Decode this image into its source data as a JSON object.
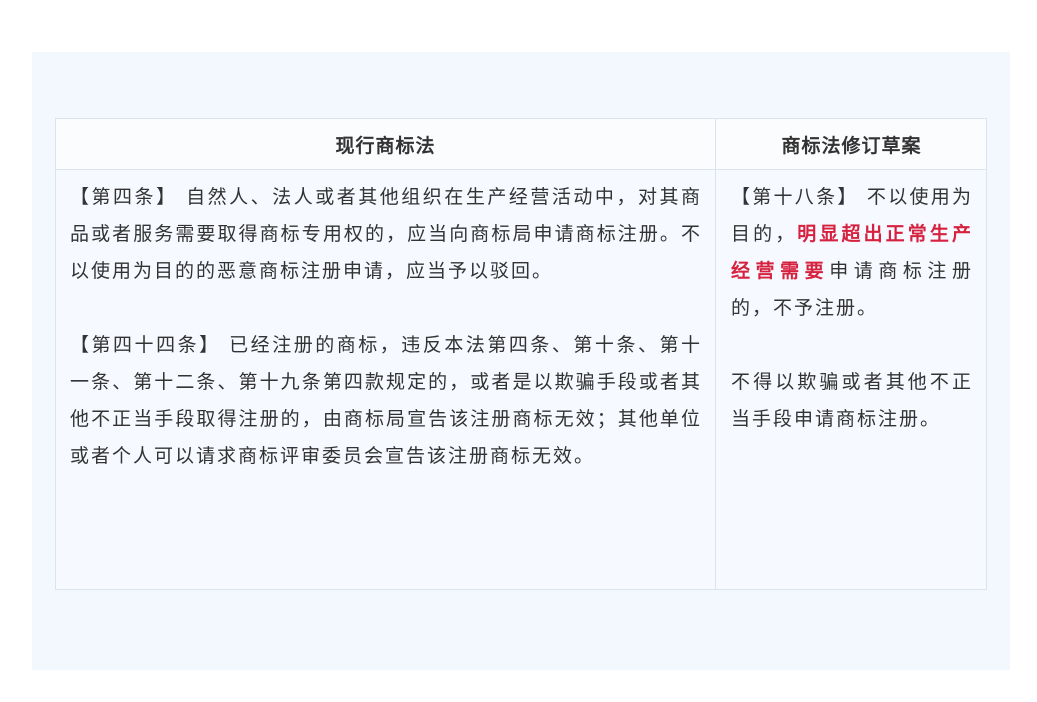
{
  "table": {
    "headers": {
      "current": "现行商标法",
      "draft": "商标法修订草案"
    },
    "current": {
      "p1": "【第四条】 自然人、法人或者其他组织在生产经营活动中，对其商品或者服务需要取得商标专用权的，应当向商标局申请商标注册。不以使用为目的的恶意商标注册申请，应当予以驳回。",
      "p2": "【第四十四条】 已经注册的商标，违反本法第四条、第十条、第十一条、第十二条、第十九条第四款规定的，或者是以欺骗手段或者其他不正当手段取得注册的，由商标局宣告该注册商标无效；其他单位或者个人可以请求商标评审委员会宣告该注册商标无效。"
    },
    "draft": {
      "p1_prefix": "【第十八条】 不以使用为目的，",
      "p1_highlight": "明显超出正常生产经营需要",
      "p1_suffix": "申请商标注册的，不予注册。",
      "p2": "不得以欺骗或者其他不正当手段申请商标注册。"
    },
    "accent_color": "#d6213f"
  }
}
